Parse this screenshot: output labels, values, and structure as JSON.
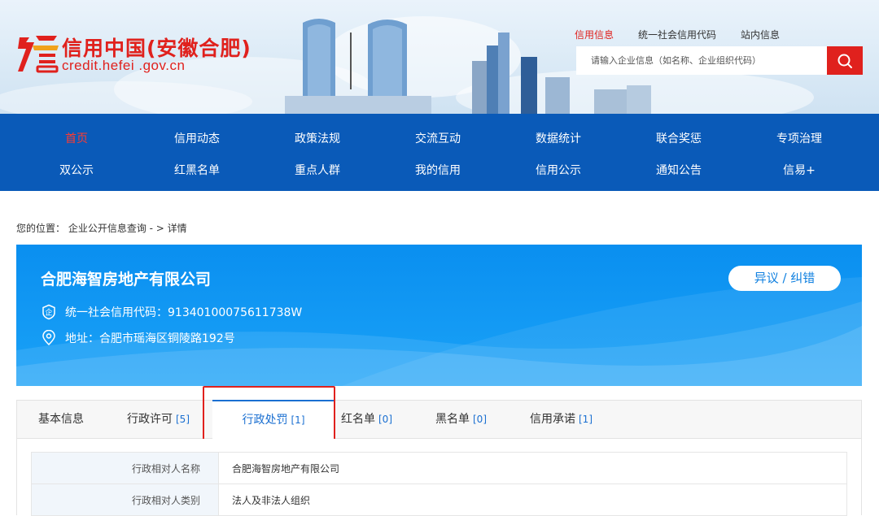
{
  "site": {
    "title": "信用中国(安徽合肥)",
    "url": "credit.hefei .gov.cn"
  },
  "top_links": [
    "信用信息",
    "统一社会信用代码",
    "站内信息"
  ],
  "search": {
    "placeholder": "请输入企业信息（如名称、企业组织代码）"
  },
  "nav": {
    "row1": [
      "首页",
      "信用动态",
      "政策法规",
      "交流互动",
      "数据统计",
      "联合奖惩",
      "专项治理"
    ],
    "row2": [
      "双公示",
      "红黑名单",
      "重点人群",
      "我的信用",
      "信用公示",
      "通知公告",
      "信易+"
    ],
    "active": "首页"
  },
  "breadcrumb": "您的位置： 企业公开信息查询 - > 详情",
  "company": {
    "name": "合肥海智房地产有限公司",
    "credit_code": "统一社会信用代码：91340100075611738W",
    "address": "地址：合肥市瑶海区铜陵路192号",
    "objection_label": "异议 / 纠错"
  },
  "tabs": [
    {
      "label": "基本信息",
      "count": ""
    },
    {
      "label": "行政许可",
      "count": "[5]"
    },
    {
      "label": "行政处罚",
      "count": "[1]"
    },
    {
      "label": "红名单",
      "count": "[0]"
    },
    {
      "label": "黑名单",
      "count": "[0]"
    },
    {
      "label": "信用承诺",
      "count": "[1]"
    }
  ],
  "active_tab": "行政处罚",
  "details": [
    {
      "key": "行政相对人名称",
      "value": "合肥海智房地产有限公司"
    },
    {
      "key": "行政相对人类别",
      "value": "法人及非法人组织"
    }
  ],
  "colors": {
    "brand_red": "#e0211d",
    "nav_blue": "#0a5ab8",
    "banner_blue": "#0a8ff0",
    "link_blue": "#1a6fd1"
  },
  "icons": [
    "logo-mark",
    "search-icon",
    "credit-code-icon",
    "location-icon"
  ]
}
